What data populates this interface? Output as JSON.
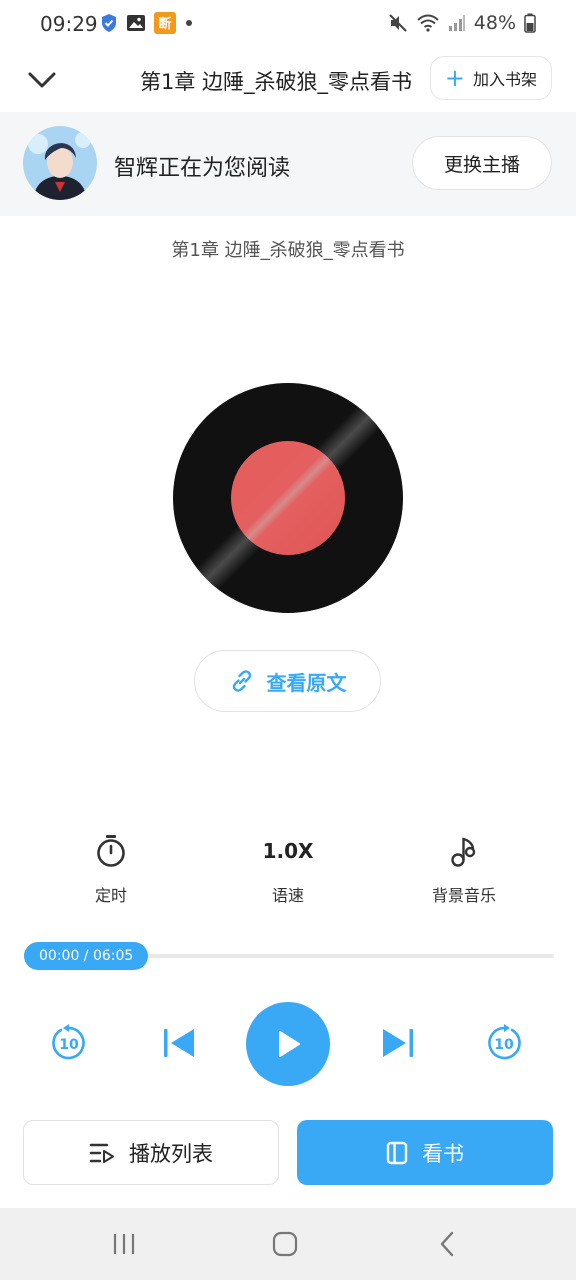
{
  "status_bar": {
    "time": "09:29",
    "battery": "48%",
    "left_icons": [
      "shield-check-icon",
      "gallery-icon",
      "app-icon",
      "dot-icon"
    ],
    "right_icons": [
      "mute-icon",
      "wifi-icon",
      "signal-icon",
      "battery-icon"
    ]
  },
  "header": {
    "title": "第1章 边陲_杀破狼_零点看书",
    "add_shelf_label": "加入书架"
  },
  "narrator": {
    "text": "智辉正在为您阅读",
    "change_label": "更换主播"
  },
  "chapter_subtitle": "第1章 边陲_杀破狼_零点看书",
  "view_original_label": "查看原文",
  "controls": {
    "timer_label": "定时",
    "speed_value": "1.0X",
    "speed_label": "语速",
    "music_label": "背景音乐"
  },
  "progress": {
    "text": "00:00 / 06:05",
    "fraction": 0
  },
  "player": {
    "rewind_text": "10",
    "forward_text": "10"
  },
  "bottom": {
    "playlist_label": "播放列表",
    "read_label": "看书"
  },
  "colors": {
    "accent": "#3aa9f5",
    "record_center": "#e35d5d"
  }
}
